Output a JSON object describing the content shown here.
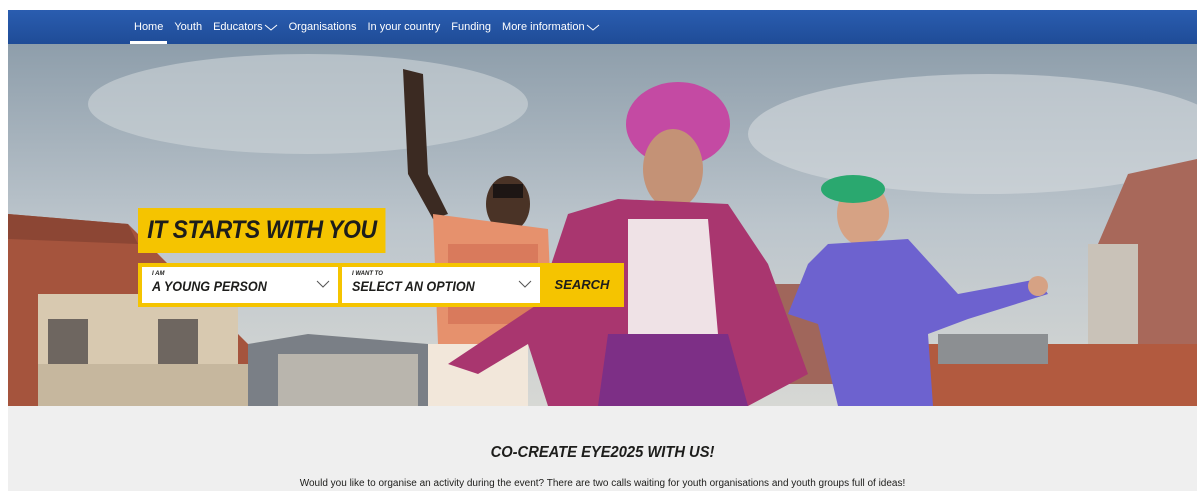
{
  "nav": {
    "items": [
      {
        "label": "Home",
        "active": true,
        "has_dropdown": false
      },
      {
        "label": "Youth",
        "active": false,
        "has_dropdown": false
      },
      {
        "label": "Educators",
        "active": false,
        "has_dropdown": true
      },
      {
        "label": "Organisations",
        "active": false,
        "has_dropdown": false
      },
      {
        "label": "In your country",
        "active": false,
        "has_dropdown": false
      },
      {
        "label": "Funding",
        "active": false,
        "has_dropdown": false
      },
      {
        "label": "More information",
        "active": false,
        "has_dropdown": true
      }
    ],
    "background_color": "#2a5db0"
  },
  "hero": {
    "title": "IT STARTS WITH YOU",
    "accent_color": "#f5c400",
    "search": {
      "who_label": "I AM",
      "who_value": "A YOUNG PERSON",
      "want_label": "I WANT TO",
      "want_value": "SELECT AN OPTION",
      "button_label": "SEARCH"
    }
  },
  "cta": {
    "title": "CO-CREATE EYE2025 WITH US!",
    "text": "Would you like to organise an activity during the event? There are two calls waiting for youth organisations and youth groups full of ideas!"
  }
}
